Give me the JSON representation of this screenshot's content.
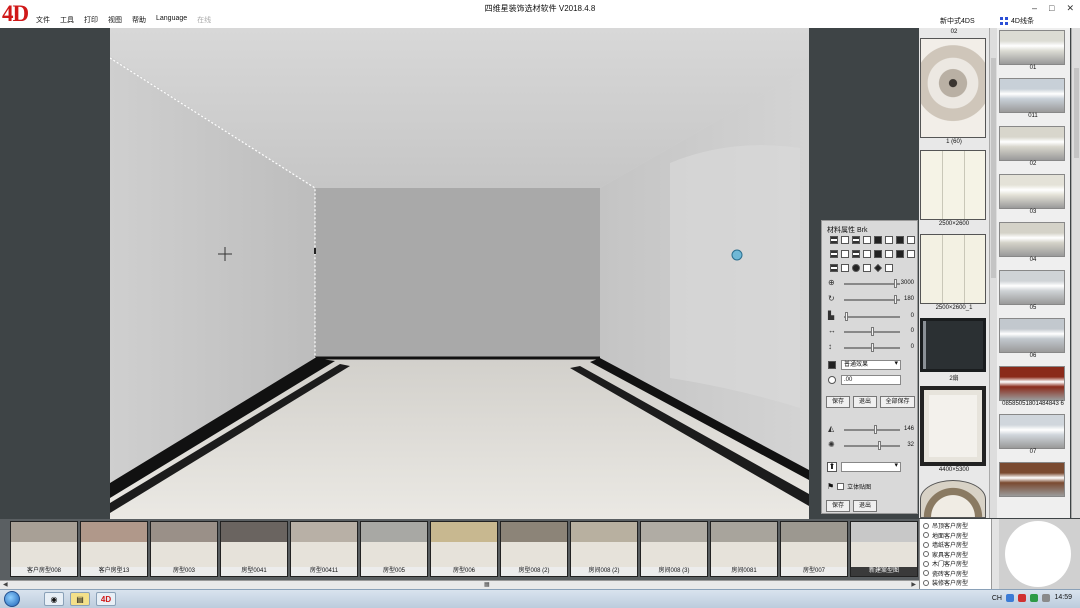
{
  "app": {
    "logo": "4D",
    "title": "四维星装饰选材软件 V2018.4.8",
    "menu": [
      "文件",
      "工具",
      "打印",
      "视图",
      "帮助",
      "Language"
    ],
    "menu_disabled": "在线",
    "top_tabs": [
      "新中式4DS",
      "4D线条"
    ],
    "window_controls": [
      "–",
      "□",
      "✕"
    ]
  },
  "properties": {
    "title": "材料属性 Brk",
    "sliders": [
      {
        "icon": "zoom-icon",
        "value": "3000",
        "level": 0.95
      },
      {
        "icon": "rotate-icon",
        "value": "180",
        "level": 0.95
      },
      {
        "icon": "offset-icon",
        "value": "0",
        "level": 0.02
      },
      {
        "icon": "horizontal-icon",
        "value": "0",
        "level": 0.5
      },
      {
        "icon": "vertical-icon",
        "value": "0",
        "level": 0.5
      }
    ],
    "effect_select": "普通效果",
    "input_value": ".00",
    "buttons": [
      "保存",
      "退出",
      "全部保存"
    ],
    "sliders2": [
      {
        "icon": "light-icon",
        "value": "146",
        "level": 0.57
      },
      {
        "icon": "brightness-icon",
        "value": "32",
        "level": 0.64
      }
    ],
    "checkbox_label": "立体贴图",
    "buttons2": [
      "保存",
      "退出"
    ]
  },
  "materials": [
    {
      "caption": "02",
      "kind": "label"
    },
    {
      "caption": "1 (60)",
      "kind": "marble"
    },
    {
      "caption": "2500×2600",
      "kind": "panel"
    },
    {
      "caption": "2500×2600_1",
      "kind": "panel"
    },
    {
      "caption": "2扇",
      "kind": "door"
    },
    {
      "caption": "4400×5300",
      "kind": "frame"
    }
  ],
  "mouldings": [
    {
      "caption": "01",
      "color": "#dcdcd4"
    },
    {
      "caption": "011",
      "color": "#c8d0d8"
    },
    {
      "caption": "02",
      "color": "#d8d6cc"
    },
    {
      "caption": "03",
      "color": "#e4e2d8"
    },
    {
      "caption": "04",
      "color": "#d4d2c8"
    },
    {
      "caption": "05",
      "color": "#cfd3d6"
    },
    {
      "caption": "06",
      "color": "#c2c8ce"
    },
    {
      "caption": "08585051801484843 6",
      "color": "#8a2a1a"
    },
    {
      "caption": "07",
      "color": "#d0d6dc"
    },
    {
      "caption": "",
      "color": "#7a4a30"
    }
  ],
  "rooms": [
    {
      "label": "客户房型008",
      "color": "#a8a096"
    },
    {
      "label": "客户房型13",
      "color": "#b0988a"
    },
    {
      "label": "房型003",
      "color": "#9a9088"
    },
    {
      "label": "房型0041",
      "color": "#6a6460"
    },
    {
      "label": "房型00411",
      "color": "#b8b0a6"
    },
    {
      "label": "房型005",
      "color": "#a8a8a4"
    },
    {
      "label": "房型006",
      "color": "#c8b890"
    },
    {
      "label": "房型008 (2)",
      "color": "#8c8478"
    },
    {
      "label": "房间008 (2)",
      "color": "#b8b0a0"
    },
    {
      "label": "房间008 (3)",
      "color": "#b0aca4"
    },
    {
      "label": "房间0081",
      "color": "#a8a49c"
    },
    {
      "label": "房型007",
      "color": "#9c9890"
    },
    {
      "label": "新建案型图",
      "color": "#c8c8c8"
    }
  ],
  "categories": [
    "吊顶客户房型",
    "地面客户房型",
    "墙纸客户房型",
    "家具客户房型",
    "木门客户房型",
    "瓷砖客户房型",
    "装修客户房型"
  ],
  "taskbar": {
    "apps": [
      "explorer-icon",
      "folder-icon",
      "4d-app-icon"
    ],
    "tray_text": "CH",
    "clock": "14:59"
  }
}
